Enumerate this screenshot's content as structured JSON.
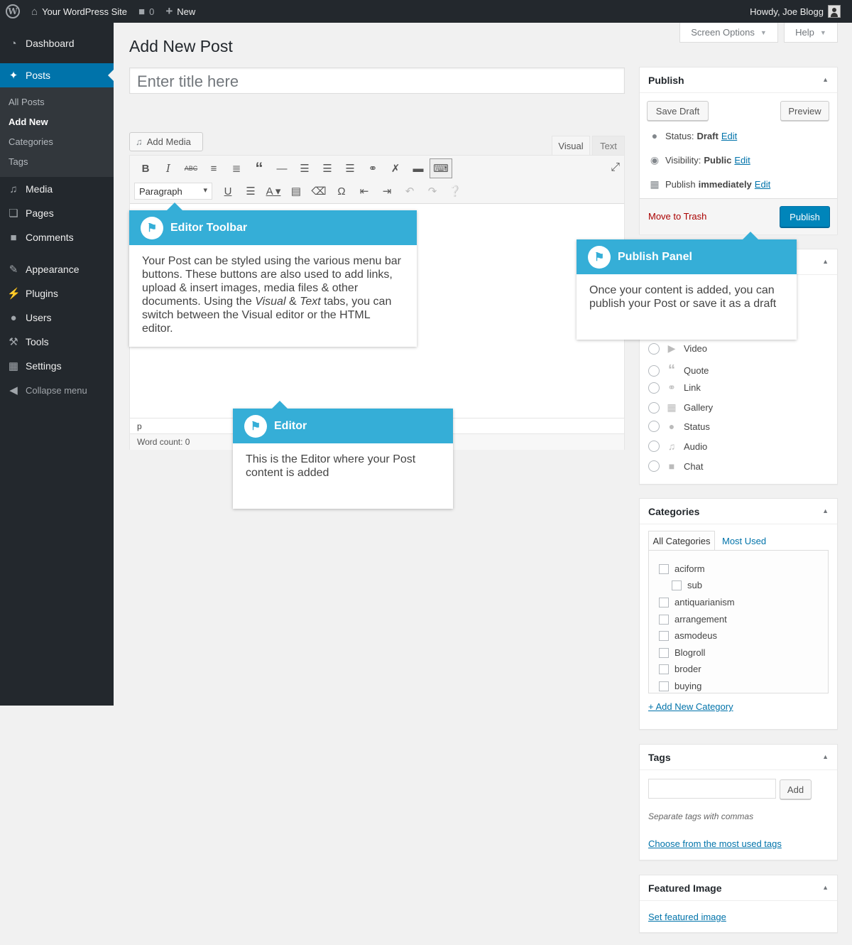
{
  "adminbar": {
    "wp_logo_icon": "wordpress-logo-icon",
    "site_name": "Your WordPress Site",
    "comments_count": "0",
    "new_label": "New",
    "howdy": "Howdy, Joe Blogg"
  },
  "sidebar": {
    "dashboard": "Dashboard",
    "posts": "Posts",
    "submenu": [
      "All Posts",
      "Add New",
      "Categories",
      "Tags"
    ],
    "media": "Media",
    "pages": "Pages",
    "comments": "Comments",
    "appearance": "Appearance",
    "plugins": "Plugins",
    "users": "Users",
    "tools": "Tools",
    "settings": "Settings",
    "collapse": "Collapse menu"
  },
  "screen_options": "Screen Options",
  "help": "Help",
  "page_title": "Add New Post",
  "title_placeholder": "Enter title here",
  "editor": {
    "add_media": "Add Media",
    "tab_visual": "Visual",
    "tab_text": "Text",
    "format_select": "Paragraph",
    "path": "p",
    "word_count": "Word count: 0"
  },
  "callouts": {
    "toolbar_title": "Editor Toolbar",
    "toolbar_body_1": "Your Post can be styled using the various menu bar buttons. These buttons are also used to add links, upload & insert images, media files & other documents. Using the ",
    "toolbar_body_visual": "Visual",
    "toolbar_body_amp": " & ",
    "toolbar_body_text": "Text",
    "toolbar_body_2": " tabs, you can switch between the Visual editor or the HTML editor.",
    "publish_title": "Publish Panel",
    "publish_body": "Once your content is added, you can publish your Post or save it as a draft",
    "editor_title": "Editor",
    "editor_body": "This is the Editor where your Post content is added"
  },
  "publish": {
    "title": "Publish",
    "save_draft": "Save Draft",
    "preview": "Preview",
    "status_label": "Status:",
    "status_value": "Draft",
    "visibility_label": "Visibility:",
    "visibility_value": "Public",
    "publish_label": "Publish",
    "publish_value": "immediately",
    "edit": "Edit",
    "trash": "Move to Trash",
    "publish_button": "Publish"
  },
  "formats": [
    "Video",
    "Quote",
    "Link",
    "Gallery",
    "Status",
    "Audio",
    "Chat"
  ],
  "categories": {
    "title": "Categories",
    "tab_all": "All Categories",
    "tab_most_used": "Most Used",
    "items": [
      "aciform",
      "sub",
      "antiquarianism",
      "arrangement",
      "asmodeus",
      "Blogroll",
      "broder",
      "buying"
    ],
    "add_new": "+ Add New Category"
  },
  "tags": {
    "title": "Tags",
    "add_button": "Add",
    "hint": "Separate tags with commas",
    "choose_link": "Choose from the most used tags"
  },
  "featured": {
    "title": "Featured Image",
    "set_link": "Set featured image"
  },
  "colors": {
    "admin_dark": "#23282d",
    "accent_blue": "#0073aa",
    "callout_blue": "#35aed7",
    "trash_red": "#a00"
  }
}
